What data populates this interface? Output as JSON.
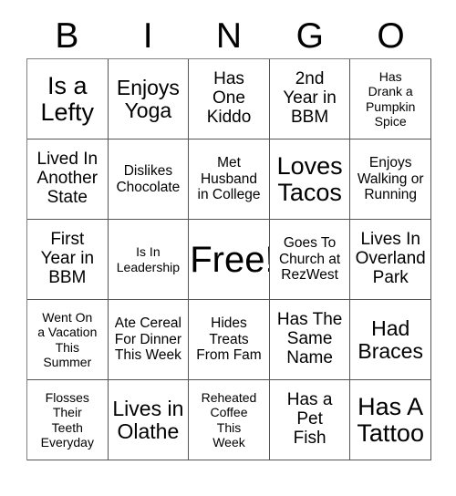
{
  "card": {
    "title": "BINGO Card",
    "header_letters": [
      "B",
      "I",
      "N",
      "G",
      "O"
    ],
    "columns": 5,
    "rows": 5,
    "free_space_label": "Free!",
    "colors": {
      "background": "#ffffff",
      "text": "#000000",
      "grid_line": "#555555",
      "outer_border": "#808080"
    },
    "squares": [
      {
        "text": "Is a\nLefty",
        "size": "xl",
        "row": 1,
        "col": 1
      },
      {
        "text": "Enjoys\nYoga",
        "size": "lg",
        "row": 1,
        "col": 2
      },
      {
        "text": "Has\nOne\nKiddo",
        "size": "md",
        "row": 1,
        "col": 3
      },
      {
        "text": "2nd\nYear in\nBBM",
        "size": "md",
        "row": 1,
        "col": 4
      },
      {
        "text": "Has\nDrank a\nPumpkin\nSpice",
        "size": "xs",
        "row": 1,
        "col": 5
      },
      {
        "text": "Lived In\nAnother\nState",
        "size": "md",
        "row": 2,
        "col": 1
      },
      {
        "text": "Dislikes\nChocolate",
        "size": "sm",
        "row": 2,
        "col": 2
      },
      {
        "text": "Met\nHusband\nin College",
        "size": "sm",
        "row": 2,
        "col": 3
      },
      {
        "text": "Loves\nTacos",
        "size": "xl",
        "row": 2,
        "col": 4
      },
      {
        "text": "Enjoys\nWalking or\nRunning",
        "size": "sm",
        "row": 2,
        "col": 5
      },
      {
        "text": "First\nYear in\nBBM",
        "size": "md",
        "row": 3,
        "col": 1
      },
      {
        "text": "Is In\nLeadership",
        "size": "xs",
        "row": 3,
        "col": 2
      },
      {
        "text": "Free!",
        "size": "xxl",
        "row": 3,
        "col": 3
      },
      {
        "text": "Goes To\nChurch at\nRezWest",
        "size": "sm",
        "row": 3,
        "col": 4
      },
      {
        "text": "Lives In\nOverland\nPark",
        "size": "md",
        "row": 3,
        "col": 5
      },
      {
        "text": "Went On\na Vacation\nThis\nSummer",
        "size": "xs",
        "row": 4,
        "col": 1
      },
      {
        "text": "Ate Cereal\nFor Dinner\nThis Week",
        "size": "sm",
        "row": 4,
        "col": 2
      },
      {
        "text": "Hides\nTreats\nFrom Fam",
        "size": "sm",
        "row": 4,
        "col": 3
      },
      {
        "text": "Has The\nSame\nName",
        "size": "md",
        "row": 4,
        "col": 4
      },
      {
        "text": "Had\nBraces",
        "size": "lg",
        "row": 4,
        "col": 5
      },
      {
        "text": "Flosses\nTheir\nTeeth\nEveryday",
        "size": "xs",
        "row": 5,
        "col": 1
      },
      {
        "text": "Lives in\nOlathe",
        "size": "lg",
        "row": 5,
        "col": 2
      },
      {
        "text": "Reheated\nCoffee\nThis\nWeek",
        "size": "xs",
        "row": 5,
        "col": 3
      },
      {
        "text": "Has a\nPet\nFish",
        "size": "md",
        "row": 5,
        "col": 4
      },
      {
        "text": "Has A\nTattoo",
        "size": "xl",
        "row": 5,
        "col": 5
      }
    ]
  }
}
